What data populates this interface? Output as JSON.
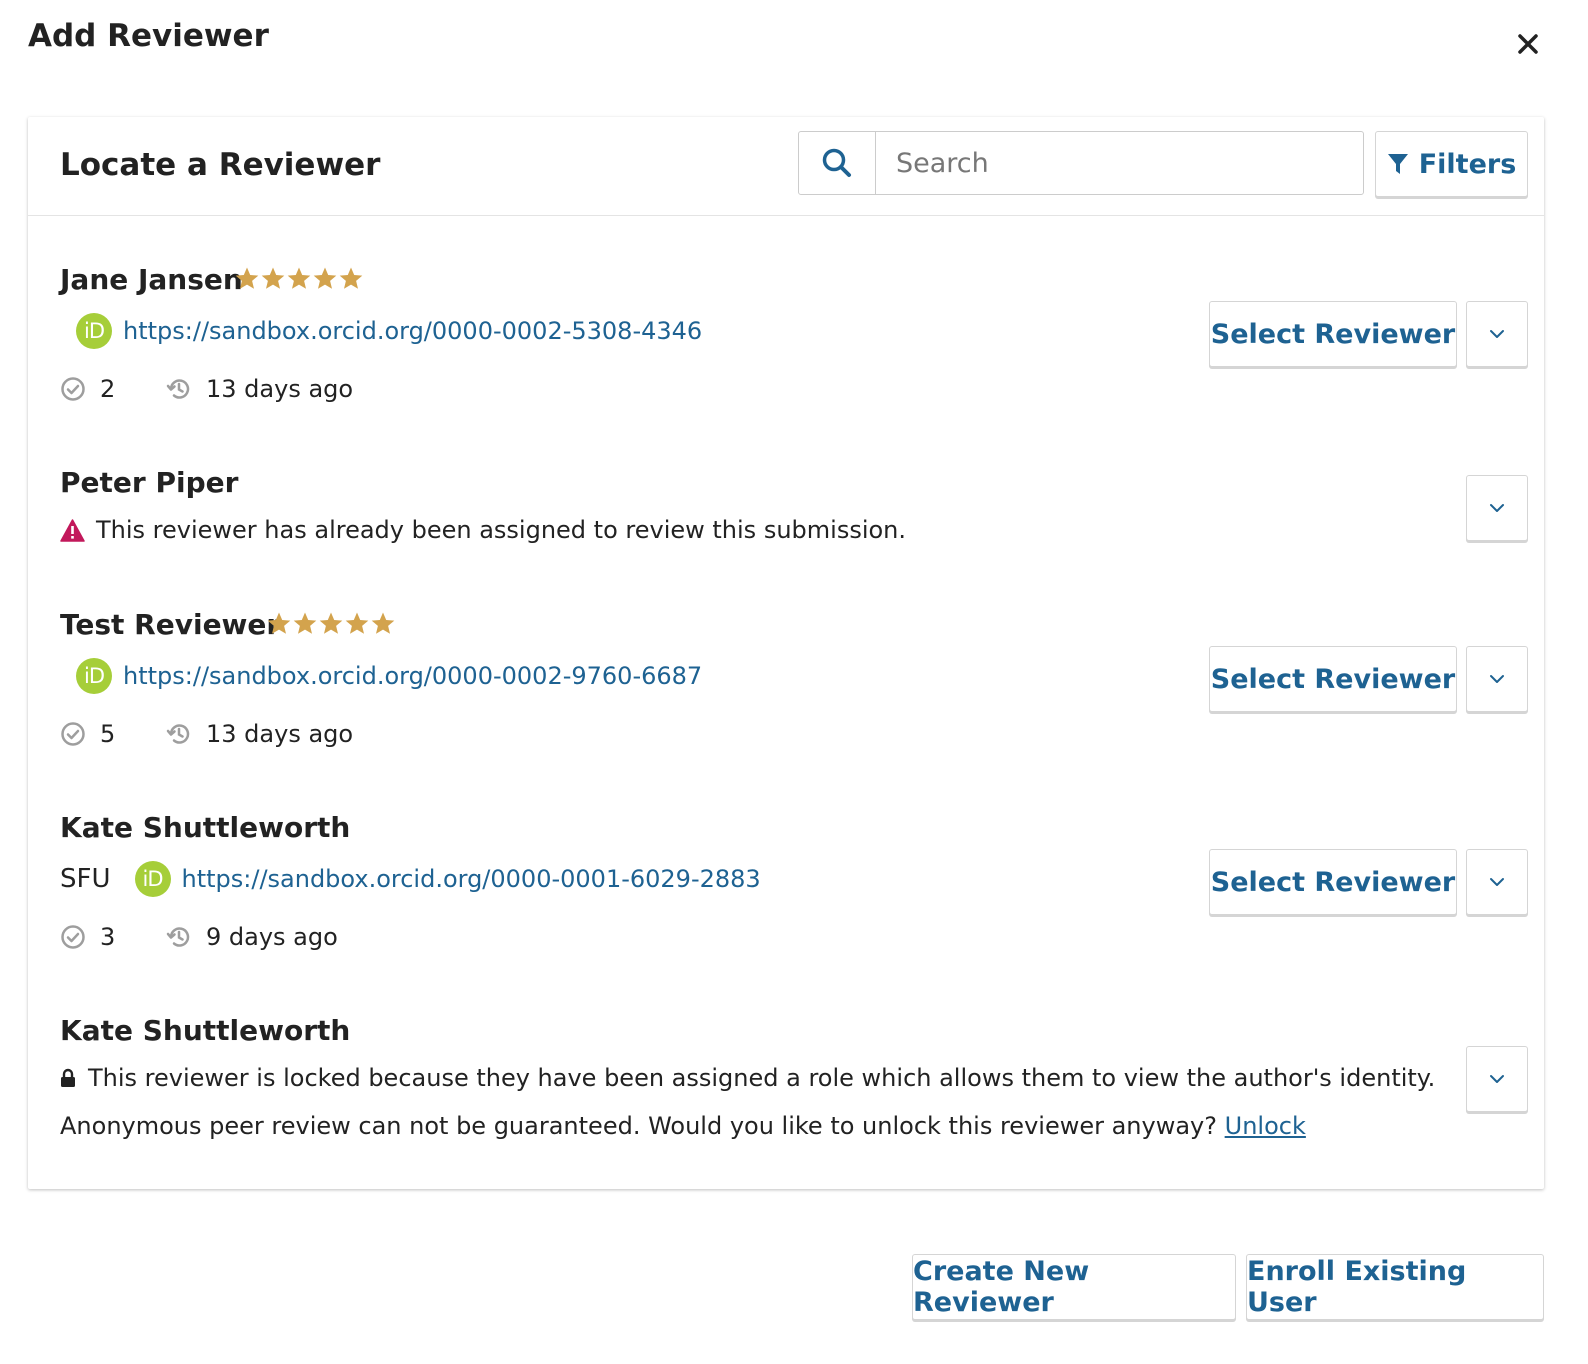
{
  "modal": {
    "title": "Add Reviewer",
    "close_icon": "close-icon"
  },
  "panel": {
    "title": "Locate a Reviewer",
    "search": {
      "placeholder": "Search",
      "value": ""
    },
    "filters_label": "Filters"
  },
  "colors": {
    "link": "#1e6292",
    "star": "#d3a34d",
    "orcid": "#a6ce39",
    "warning": "#c2185b",
    "muted_icon": "#9e9e9e"
  },
  "reviewers": [
    {
      "name": "Jane Jansen",
      "rating": 5,
      "orcid": "https://sandbox.orcid.org/0000-0002-5308-4346",
      "completed": "2",
      "last_active": "13 days ago",
      "select_label": "Select Reviewer"
    },
    {
      "name": "Peter Piper",
      "notice": "This reviewer has already been assigned to review this submission."
    },
    {
      "name": "Test Reviewer",
      "rating": 5,
      "orcid": "https://sandbox.orcid.org/0000-0002-9760-6687",
      "completed": "5",
      "last_active": "13 days ago",
      "select_label": "Select Reviewer"
    },
    {
      "name": "Kate Shuttleworth",
      "affiliation": "SFU",
      "orcid": "https://sandbox.orcid.org/0000-0001-6029-2883",
      "completed": "3",
      "last_active": "9 days ago",
      "select_label": "Select Reviewer"
    },
    {
      "name": "Kate Shuttleworth",
      "notice": "This reviewer is locked because they have been assigned a role which allows them to view the author's identity.",
      "notice_line2": "Anonymous peer review can not be guaranteed. Would you like to unlock this reviewer anyway?",
      "unlock_label": "Unlock"
    }
  ],
  "orcid_badge_text": "iD",
  "footer": {
    "create_label": "Create New Reviewer",
    "enroll_label": "Enroll Existing User"
  }
}
